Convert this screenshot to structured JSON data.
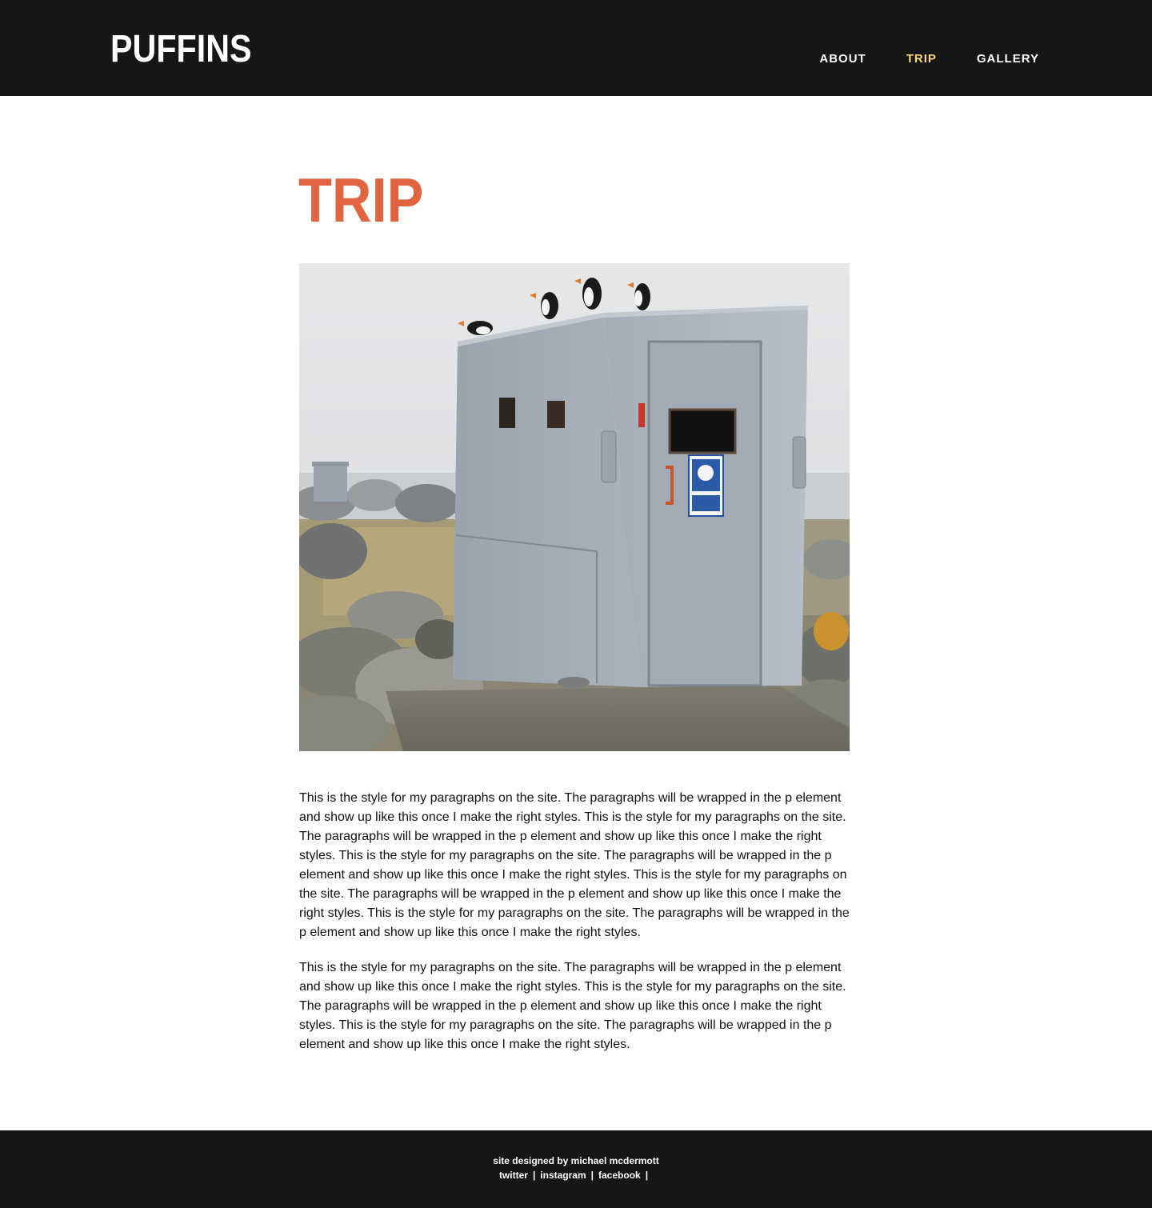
{
  "header": {
    "logo": "PUFFINS",
    "nav": [
      {
        "label": "ABOUT",
        "active": false
      },
      {
        "label": "TRIP",
        "active": true
      },
      {
        "label": "GALLERY",
        "active": false
      }
    ]
  },
  "main": {
    "title": "TRIP",
    "paragraphs": [
      "This is the style for my paragraphs on the site. The paragraphs will be wrapped in the p element and show up like this once I make the right styles. This is the style for my paragraphs on the site. The paragraphs will be wrapped in the p element and show up like this once I make the right styles. This is the style for my paragraphs on the site. The paragraphs will be wrapped in the p element and show up like this once I make the right styles. This is the style for my paragraphs on the site. The paragraphs will be wrapped in the p element and show up like this once I make the right styles. This is the style for my paragraphs on the site. The paragraphs will be wrapped in the p element and show up like this once I make the right styles.",
      "This is the style for my paragraphs on the site. The paragraphs will be wrapped in the p element and show up like this once I make the right styles. This is the style for my paragraphs on the site. The paragraphs will be wrapped in the p element and show up like this once I make the right styles. This is the style for my paragraphs on the site. The paragraphs will be wrapped in the p element and show up like this once I make the right styles."
    ]
  },
  "footer": {
    "credit": "site designed by michael mcdermott",
    "links": [
      "twitter",
      "instagram",
      "facebook"
    ],
    "separator": "|"
  },
  "colors": {
    "header_bg": "#161616",
    "title": "#e0643f",
    "nav_active": "#f5d77a"
  }
}
